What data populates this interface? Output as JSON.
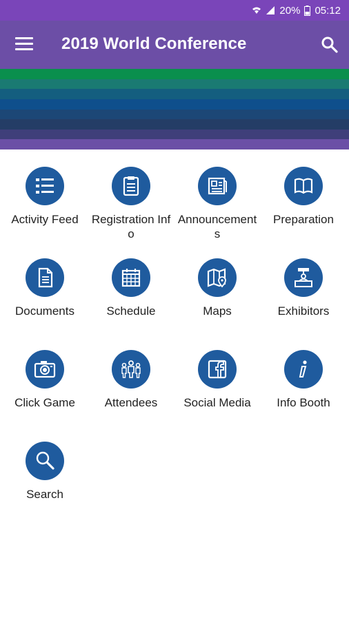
{
  "status_bar": {
    "battery": "20%",
    "time": "05:12"
  },
  "app_bar": {
    "title": "2019 World Conference"
  },
  "banner": {
    "stripes": [
      "#0a8f4d",
      "#1a7a72",
      "#145e7f",
      "#0f4f8c",
      "#1c4776",
      "#243d66",
      "#3f3f7a",
      "#6b4fa6"
    ]
  },
  "colors": {
    "status_bar": "#7a45b9",
    "app_bar": "#6c4ea6",
    "icon_circle": "#1f5b9e"
  },
  "tiles": [
    {
      "label": "Activity Feed",
      "icon": "list-icon"
    },
    {
      "label": "Registration Info",
      "icon": "clipboard-icon"
    },
    {
      "label": "Announcements",
      "icon": "newspaper-icon"
    },
    {
      "label": "Preparation",
      "icon": "book-icon"
    },
    {
      "label": "Documents",
      "icon": "document-icon"
    },
    {
      "label": "Schedule",
      "icon": "calendar-icon"
    },
    {
      "label": "Maps",
      "icon": "map-icon"
    },
    {
      "label": "Exhibitors",
      "icon": "booth-icon"
    },
    {
      "label": "Click Game",
      "icon": "camera-icon"
    },
    {
      "label": "Attendees",
      "icon": "people-icon"
    },
    {
      "label": "Social Media",
      "icon": "facebook-icon"
    },
    {
      "label": "Info Booth",
      "icon": "info-icon"
    },
    {
      "label": "Search",
      "icon": "magnifier-icon"
    }
  ]
}
